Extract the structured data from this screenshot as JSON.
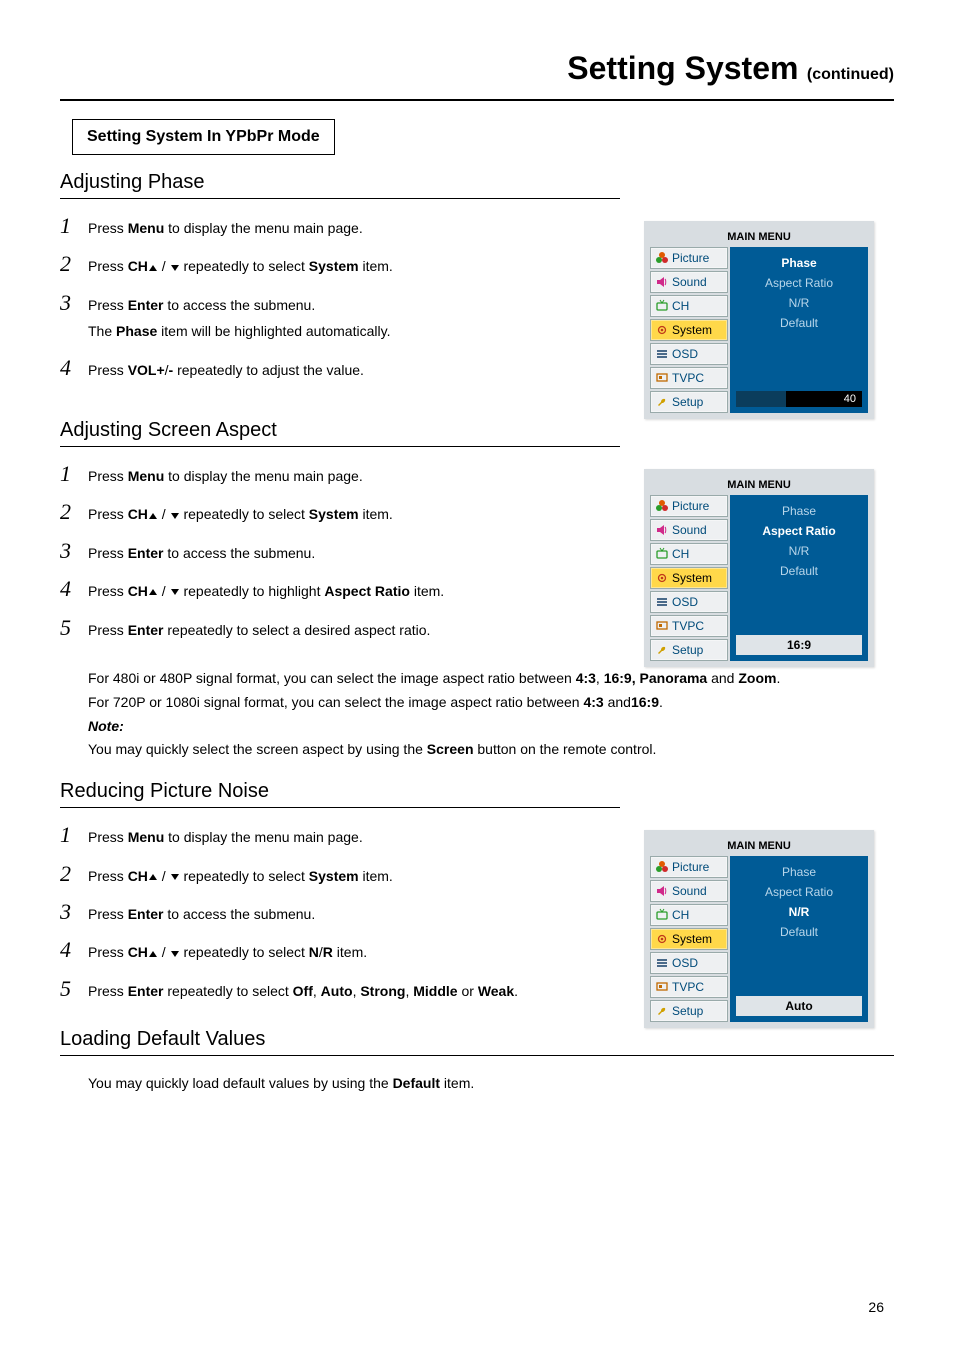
{
  "header": {
    "title": "Setting System",
    "continued": "(continued)"
  },
  "boxed": "Setting System In YPbPr Mode",
  "sections": {
    "phase": {
      "title": "Adjusting Phase",
      "s1a": "Press ",
      "s1menu": "Menu",
      "s1b": " to display the menu main page.",
      "s2a": "Press ",
      "s2ch": "CH",
      "s2b": " repeatedly to select ",
      "s2sys": "System",
      "s2c": " item.",
      "s3a": "Press ",
      "s3enter": "Enter",
      "s3b": " to access the submenu.",
      "s3sub_a": "The ",
      "s3sub_b": "Phase",
      "s3sub_c": " item will be highlighted automatically.",
      "s4a": "Press ",
      "s4vol": "VOL",
      "s4plus": "+",
      "s4slash": "/",
      "s4minus": "-",
      "s4b": " repeatedly to adjust the value."
    },
    "aspect": {
      "title": "Adjusting Screen Aspect",
      "s1a": "Press ",
      "s1menu": "Menu",
      "s1b": " to display the menu main page.",
      "s2a": "Press ",
      "s2ch": "CH",
      "s2b": " repeatedly to select ",
      "s2sys": "System",
      "s2c": " item.",
      "s3a": "Press ",
      "s3enter": "Enter",
      "s3b": " to access the submenu.",
      "s4a": "Press ",
      "s4ch": "CH",
      "s4b": " repeatedly to highlight ",
      "s4ar": "Aspect Ratio",
      "s4c": " item.",
      "s5a": "Press ",
      "s5enter": "Enter",
      "s5b": " repeatedly to select a desired aspect ratio.",
      "note1a": "For 480i or 480P signal format, you can select the image aspect ratio between ",
      "note1b": "4:3",
      "note1comma": ",",
      "note1c": " 16:9,",
      "note1d": " Panorama",
      "note1e": " and ",
      "note1f": "Zoom",
      "note1g": ".",
      "note2a": "For 720P or 1080i signal format, you can select the image aspect ratio between ",
      "note2b": "4:3",
      "note2c": " and",
      "note2d": "16:9",
      "note2e": ".",
      "note_label": "Note:",
      "note3a": "You may quickly select the screen aspect by using the ",
      "note3b": "Screen",
      "note3c": " button on the remote control."
    },
    "noise": {
      "title": "Reducing Picture Noise",
      "s1a": "Press ",
      "s1menu": "Menu",
      "s1b": " to display the menu main page.",
      "s2a": "Press ",
      "s2ch": "CH",
      "s2b": " repeatedly to select ",
      "s2sys": "System",
      "s2c": " item.",
      "s3a": "Press ",
      "s3enter": "Enter",
      "s3b": " to access the submenu.",
      "s4a": "Press ",
      "s4ch": "CH",
      "s4b": " repeatedly to select ",
      "s4n": "N",
      "s4slash": "/",
      "s4r": "R",
      "s4c": " item.",
      "s5a": "Press ",
      "s5enter": "Enter",
      "s5b": " repeatedly to select ",
      "s5off": "Off",
      "s5c1": ", ",
      "s5auto": "Auto",
      "s5c2": ", ",
      "s5strong": "Strong",
      "s5c3": ", ",
      "s5middle": "Middle",
      "s5c4": " or ",
      "s5weak": "Weak",
      "s5c5": "."
    },
    "defaults": {
      "title": "Loading Default Values",
      "text_a": "You may quickly load default values  by using the ",
      "text_b": "Default",
      "text_c": " item."
    }
  },
  "osd": {
    "menu_title": "MAIN MENU",
    "items": {
      "picture": "Picture",
      "sound": "Sound",
      "ch": "CH",
      "system": "System",
      "osd": "OSD",
      "tvpc": "TVPC",
      "setup": "Setup"
    },
    "opts": {
      "phase": "Phase",
      "aspect": "Aspect Ratio",
      "nr": "N/R",
      "default": "Default"
    },
    "phase_value": "40",
    "aspect_value": "16:9",
    "nr_value": "Auto"
  },
  "page_number": "26"
}
